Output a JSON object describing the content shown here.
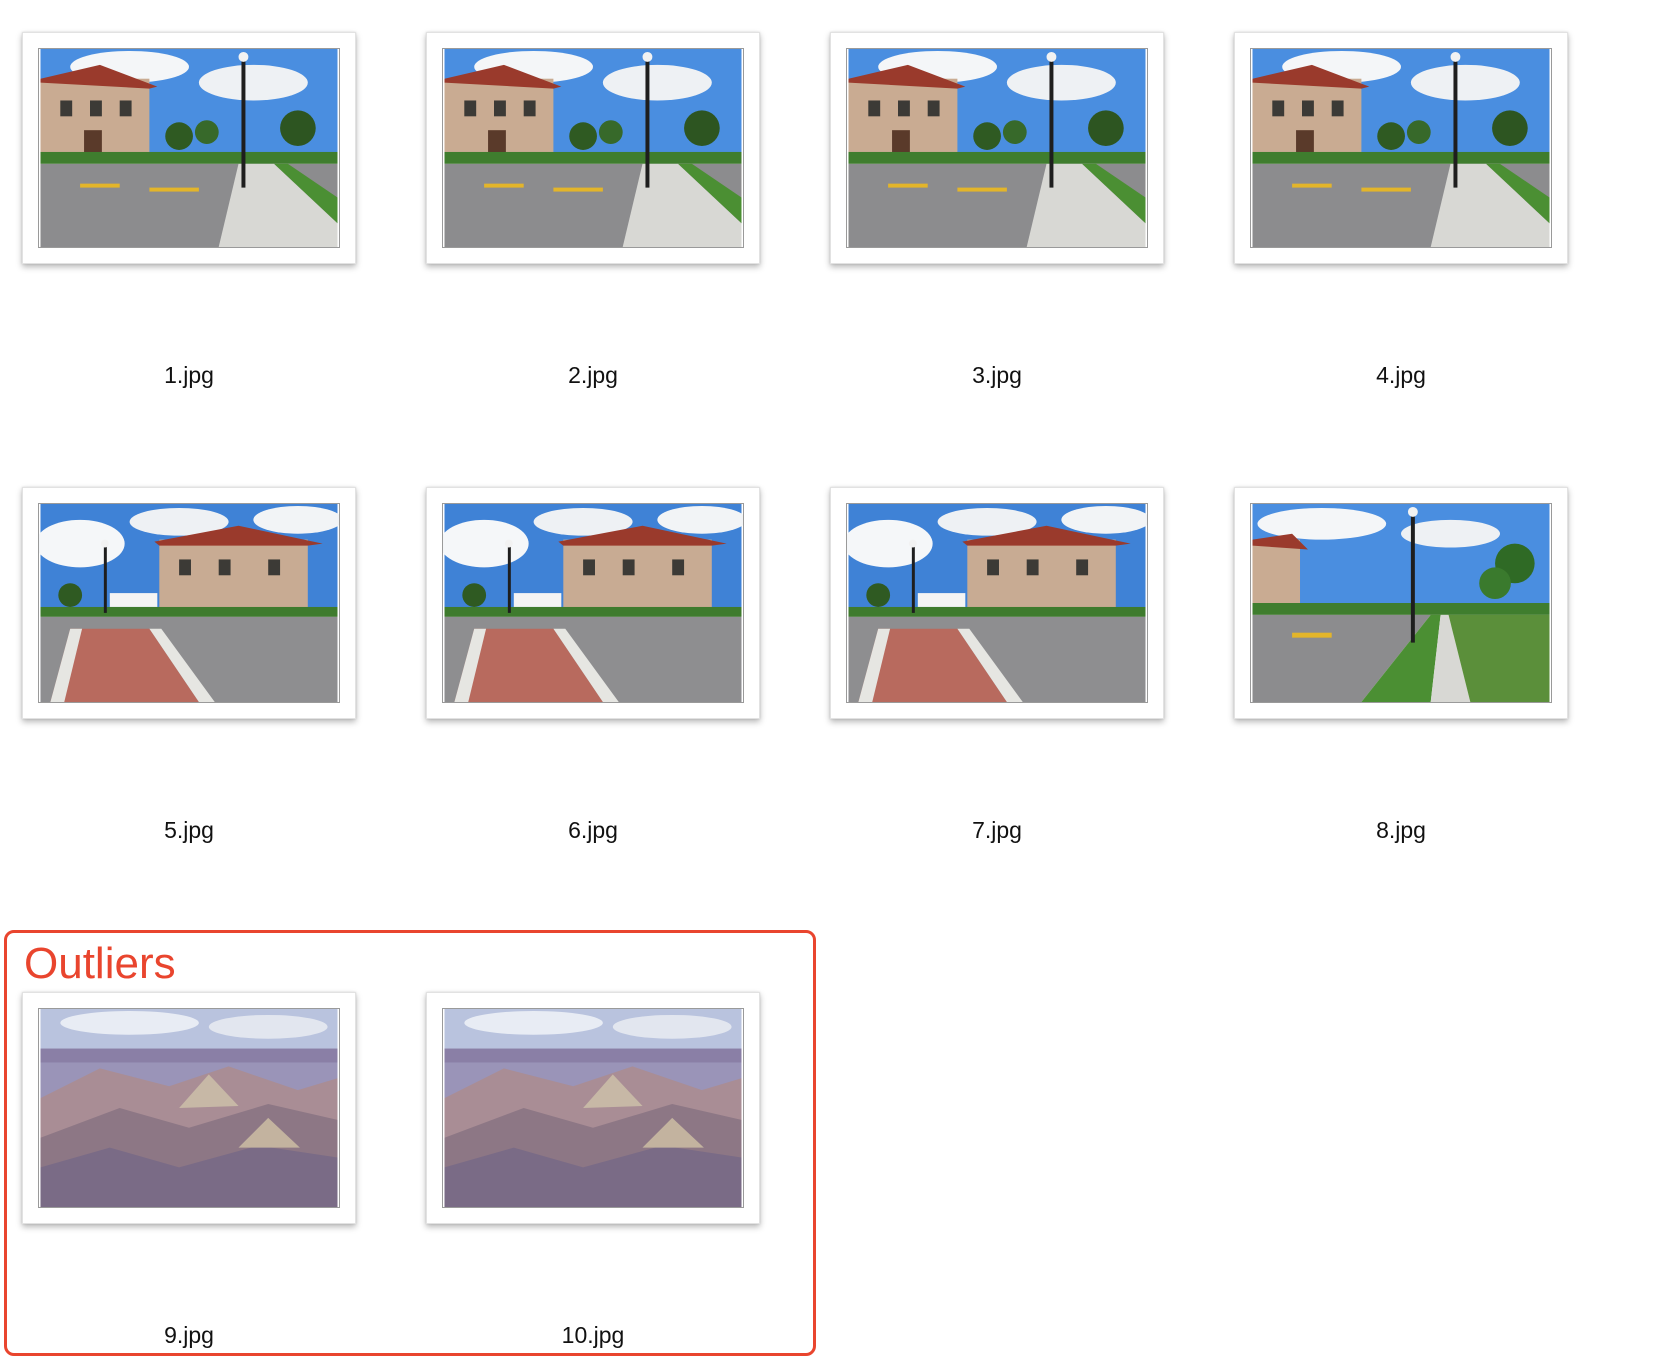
{
  "files": [
    {
      "name": "1.jpg",
      "thumbnail": "street-scene-thumbnail"
    },
    {
      "name": "2.jpg",
      "thumbnail": "street-scene-thumbnail"
    },
    {
      "name": "3.jpg",
      "thumbnail": "street-scene-thumbnail"
    },
    {
      "name": "4.jpg",
      "thumbnail": "street-scene-thumbnail"
    },
    {
      "name": "5.jpg",
      "thumbnail": "street-crosswalk-thumbnail"
    },
    {
      "name": "6.jpg",
      "thumbnail": "street-crosswalk-thumbnail"
    },
    {
      "name": "7.jpg",
      "thumbnail": "street-crosswalk-thumbnail"
    },
    {
      "name": "8.jpg",
      "thumbnail": "street-sidewalk-thumbnail"
    }
  ],
  "outliers": {
    "title": "Outliers",
    "accent_color": "#e9452e",
    "files": [
      {
        "name": "9.jpg",
        "thumbnail": "canyon-thumbnail"
      },
      {
        "name": "10.jpg",
        "thumbnail": "canyon-thumbnail"
      }
    ]
  }
}
